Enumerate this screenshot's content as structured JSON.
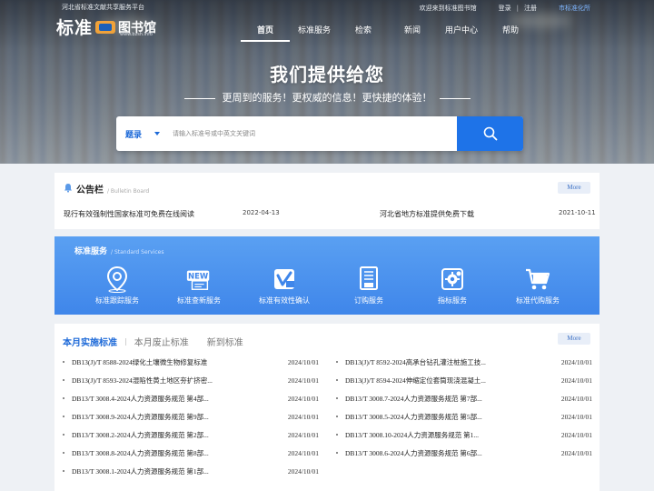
{
  "header": {
    "platform_name": "河北省标准文献共享服务平台",
    "welcome": "欢迎来到标准图书馆",
    "login": "登录",
    "separator": "|",
    "register": "注册",
    "digitization": "市标准化所",
    "logo_main": "标准",
    "logo_sub": "图书馆",
    "logo_url": "www.bzsh.info"
  },
  "nav": {
    "items": [
      {
        "label": "首页",
        "active": true
      },
      {
        "label": "标准服务"
      },
      {
        "label": "检索"
      },
      {
        "label": "新闻"
      },
      {
        "label": "用户中心"
      },
      {
        "label": "帮助"
      }
    ]
  },
  "hero": {
    "title": "我们提供给您",
    "subtitle": "更周到的服务！更权威的信息！更快捷的体验！"
  },
  "search": {
    "type": "题录",
    "placeholder": "请输入标准号或中英文关键词"
  },
  "bulletin": {
    "title": "公告栏",
    "title_en": "/ Bulletin Board",
    "more": "More",
    "items": [
      {
        "title": "现行有效强制性国家标准可免费在线阅读",
        "date": "2022-04-13"
      },
      {
        "title": "河北省地方标准提供免费下载",
        "date": "2021-10-11"
      }
    ]
  },
  "services": {
    "title": "标准服务",
    "title_en": "/ Standard Services",
    "items": [
      {
        "label": "标准跟踪服务",
        "icon": "location-pin-icon"
      },
      {
        "label": "标准查新服务",
        "icon": "new-badge-icon"
      },
      {
        "label": "标准有效性确认",
        "icon": "validity-check-icon"
      },
      {
        "label": "订购服务",
        "icon": "order-document-icon"
      },
      {
        "label": "指标服务",
        "icon": "settings-gear-icon"
      },
      {
        "label": "标准代购服务",
        "icon": "shopping-cart-icon"
      }
    ]
  },
  "standards": {
    "tabs": [
      "本月实施标准",
      "本月废止标准",
      "新到标准"
    ],
    "tab_separator": "|",
    "more": "More",
    "left": [
      {
        "name": "DB13(J)/T 8588-2024绿化土壤微生物修复标准",
        "date": "2024/10/01"
      },
      {
        "name": "DB13(J)/T 8593-2024湿陷性黄土地区夯扩挤密...",
        "date": "2024/10/01"
      },
      {
        "name": "DB13/T 3008.4-2024人力资源服务规范 第4部...",
        "date": "2024/10/01"
      },
      {
        "name": "DB13/T 3008.9-2024人力资源服务规范 第9部...",
        "date": "2024/10/01"
      },
      {
        "name": "DB13/T 3008.2-2024人力资源服务规范 第2部...",
        "date": "2024/10/01"
      },
      {
        "name": "DB13/T 3008.8-2024人力资源服务规范 第8部...",
        "date": "2024/10/01"
      },
      {
        "name": "DB13/T 3008.1-2024人力资源服务规范 第1部...",
        "date": "2024/10/01"
      }
    ],
    "right": [
      {
        "name": "DB13(J)/T 8592-2024高承台钻孔灌注桩施工技...",
        "date": "2024/10/01"
      },
      {
        "name": "DB13(J)/T 8594-2024伸缩定位套筒现浇混凝土...",
        "date": "2024/10/01"
      },
      {
        "name": "DB13/T 3008.7-2024人力资源服务规范 第7部...",
        "date": "2024/10/01"
      },
      {
        "name": "DB13/T 3008.5-2024人力资源服务规范 第5部...",
        "date": "2024/10/01"
      },
      {
        "name": "DB13/T 3008.10-2024人力资源服务规范 第1...",
        "date": "2024/10/01"
      },
      {
        "name": "DB13/T 3008.6-2024人力资源服务规范 第6部...",
        "date": "2024/10/01"
      }
    ]
  },
  "colors": {
    "accent": "#1e73e8",
    "services_bg": "#4a90ee",
    "page_bg": "#eef1f5"
  }
}
